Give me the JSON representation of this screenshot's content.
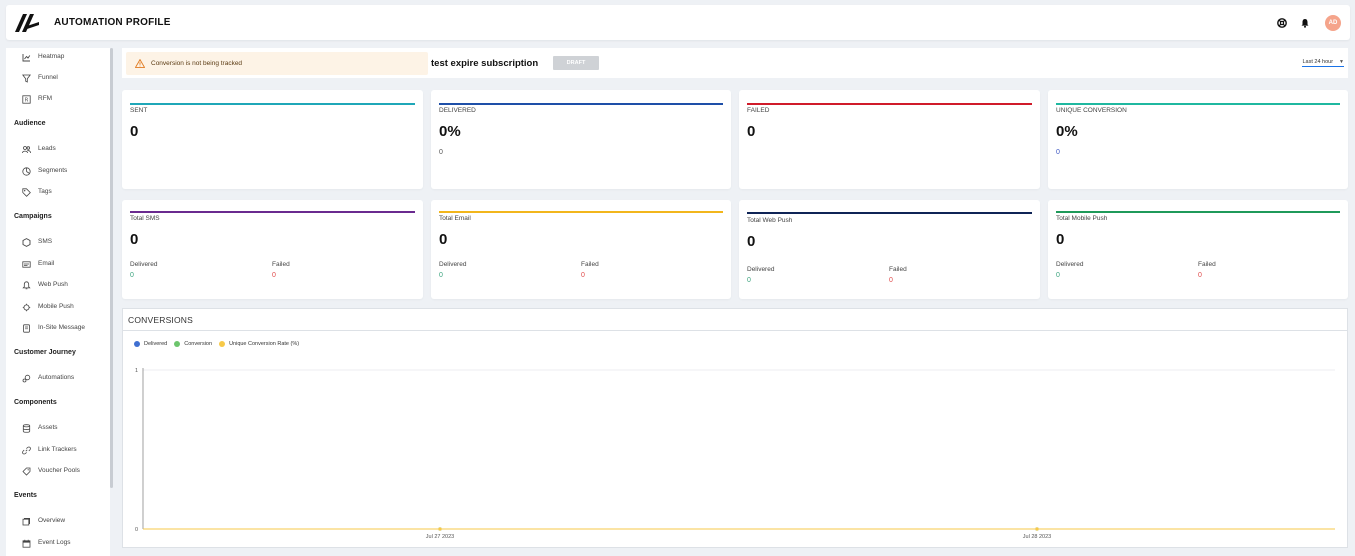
{
  "app": {
    "title": "AUTOMATION PROFILE",
    "avatar_initials": "AD"
  },
  "sidebar": {
    "top_items": [
      {
        "label": "Heatmap",
        "icon": "heatmap-icon"
      },
      {
        "label": "Funnel",
        "icon": "funnel-icon"
      },
      {
        "label": "RFM",
        "icon": "rfm-icon"
      }
    ],
    "sections": [
      {
        "title": "Audience",
        "items": [
          {
            "label": "Leads",
            "icon": "users-icon"
          },
          {
            "label": "Segments",
            "icon": "pie-icon"
          },
          {
            "label": "Tags",
            "icon": "tag-icon"
          }
        ]
      },
      {
        "title": "Campaigns",
        "items": [
          {
            "label": "SMS",
            "icon": "sms-icon"
          },
          {
            "label": "Email",
            "icon": "email-icon"
          },
          {
            "label": "Web Push",
            "icon": "bell-icon"
          },
          {
            "label": "Mobile Push",
            "icon": "mobile-push-icon"
          },
          {
            "label": "In-Site Message",
            "icon": "message-icon"
          }
        ]
      },
      {
        "title": "Customer Journey",
        "items": [
          {
            "label": "Automations",
            "icon": "automation-icon"
          }
        ]
      },
      {
        "title": "Components",
        "items": [
          {
            "label": "Assets",
            "icon": "database-icon"
          },
          {
            "label": "Link Trackers",
            "icon": "link-icon"
          },
          {
            "label": "Voucher Pools",
            "icon": "voucher-icon"
          }
        ]
      },
      {
        "title": "Events",
        "items": [
          {
            "label": "Overview",
            "icon": "overview-icon"
          },
          {
            "label": "Event Logs",
            "icon": "calendar-icon"
          }
        ]
      }
    ]
  },
  "header": {
    "warning": "Conversion is not being tracked",
    "campaign_name": "test expire subscription",
    "status": "DRAFT",
    "range": "Last 24 hour"
  },
  "stats": [
    {
      "title": "SENT",
      "value": "0",
      "color": "#1fa7b8"
    },
    {
      "title": "DELIVERED",
      "value": "0%",
      "sub": "0",
      "color": "#1e4fa8"
    },
    {
      "title": "FAILED",
      "value": "0",
      "color": "#d01b2a"
    },
    {
      "title": "UNIQUE CONVERSION",
      "value": "0%",
      "sub": "0",
      "color": "#1fb8a0"
    }
  ],
  "channels": [
    {
      "title": "Total SMS",
      "value": "0",
      "delivered_label": "Delivered",
      "delivered": "0",
      "failed_label": "Failed",
      "failed": "0",
      "color": "#6a2a8f"
    },
    {
      "title": "Total Email",
      "value": "0",
      "delivered_label": "Delivered",
      "delivered": "0",
      "failed_label": "Failed",
      "failed": "0",
      "color": "#f2b61c"
    },
    {
      "title": "Total Web Push",
      "value": "0",
      "delivered_label": "Delivered",
      "delivered": "0",
      "failed_label": "Failed",
      "failed": "0",
      "color": "#0f2456"
    },
    {
      "title": "Total Mobile Push",
      "value": "0",
      "delivered_label": "Delivered",
      "delivered": "0",
      "failed_label": "Failed",
      "failed": "0",
      "color": "#1f9a5a"
    }
  ],
  "conversions": {
    "title": "CONVERSIONS",
    "legend": [
      {
        "label": "Delivered",
        "color": "#3f6fd1"
      },
      {
        "label": "Conversion",
        "color": "#6cc56c"
      },
      {
        "label": "Unique Conversion Rate (%)",
        "color": "#f7c948"
      }
    ]
  },
  "chart_data": {
    "type": "line",
    "x": [
      "Jul 27 2023",
      "Jul 28 2023"
    ],
    "ylim": [
      0,
      1
    ],
    "y_ticks": [
      "0",
      "1"
    ],
    "series": [
      {
        "name": "Delivered",
        "values": [
          0,
          0
        ],
        "color": "#3f6fd1"
      },
      {
        "name": "Conversion",
        "values": [
          0,
          0
        ],
        "color": "#6cc56c"
      },
      {
        "name": "Unique Conversion Rate (%)",
        "values": [
          0,
          0
        ],
        "color": "#f7c948"
      }
    ]
  }
}
